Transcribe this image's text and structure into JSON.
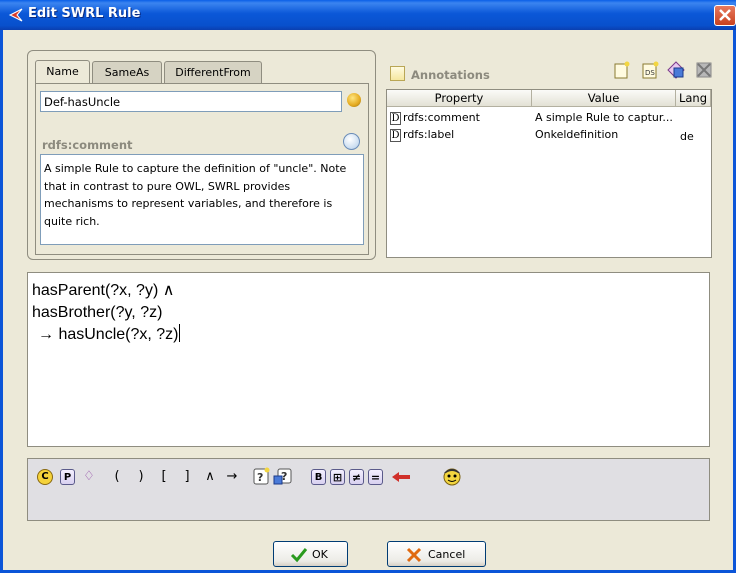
{
  "window": {
    "title": "Edit SWRL Rule"
  },
  "tabs": [
    {
      "label": "Name",
      "active": true
    },
    {
      "label": "SameAs",
      "active": false
    },
    {
      "label": "DifferentFrom",
      "active": false
    }
  ],
  "name_field": {
    "value": "Def-hasUncle"
  },
  "comment": {
    "label": "rdfs:comment",
    "lines": [
      "A simple Rule to capture the definition of \"uncle\".  Note",
      "that in contrast to pure OWL, SWRL provides",
      "mechanisms to represent variables, and therefore is",
      "quite rich."
    ]
  },
  "annotations": {
    "label": "Annotations",
    "columns": [
      "Property",
      "Value",
      "Lang"
    ],
    "rows": [
      {
        "badge": "D",
        "property": "rdfs:comment",
        "value": "A simple Rule to captur...",
        "lang": ""
      },
      {
        "badge": "D",
        "property": "rdfs:label",
        "value": "Onkeldefinition",
        "lang": "de"
      }
    ],
    "toolbar_icons": [
      "add-annotation-icon",
      "add-datatype-annotation-icon",
      "add-instance-annotation-icon",
      "delete-annotation-icon"
    ]
  },
  "rule": {
    "lines": [
      "hasParent(?x, ?y)  ∧",
      "hasBrother(?y, ?z)",
      "→  hasUncle(?x, ?z)"
    ]
  },
  "palette": {
    "symbols": [
      "C",
      "P",
      "♢",
      "(",
      ")",
      "[",
      "]",
      "∧",
      "→",
      "B",
      "⊞",
      "≠",
      "="
    ]
  },
  "buttons": {
    "ok": "OK",
    "cancel": "Cancel"
  },
  "colors": {
    "titlebar": "#0b58d8",
    "accent_arrow": "#d0302a",
    "ok_check": "#2a9a1e",
    "cancel_x": "#e06a10"
  }
}
